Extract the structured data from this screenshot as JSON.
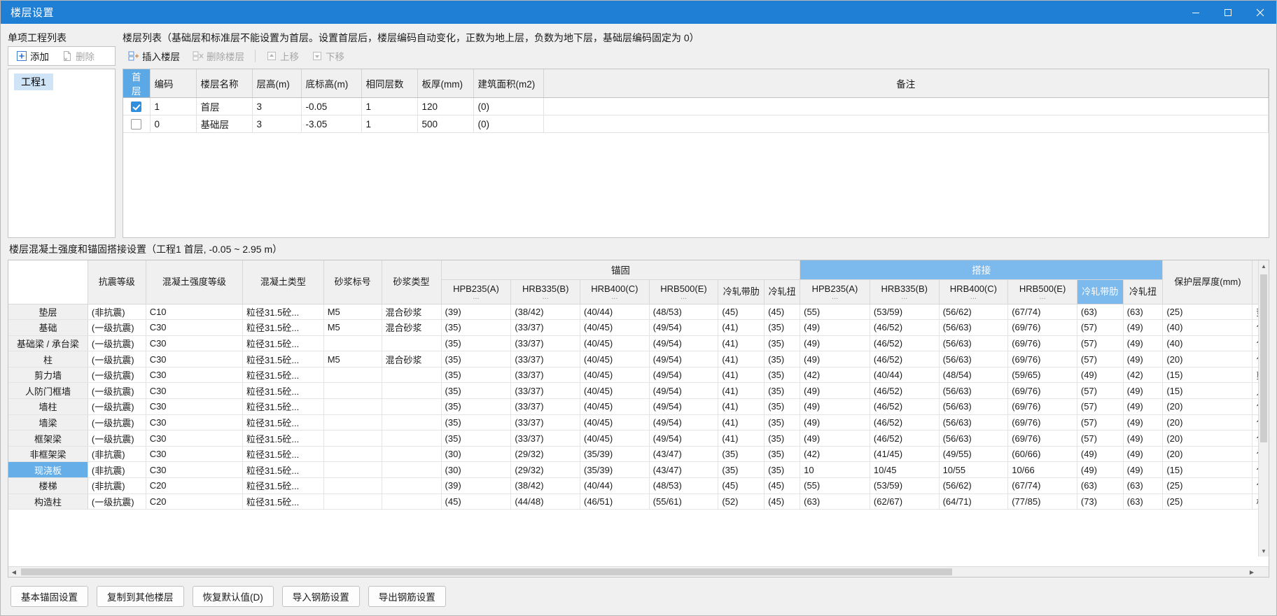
{
  "window": {
    "title": "楼层设置",
    "controls": {
      "minimize": "─",
      "maximize": "☐",
      "close": "✕"
    }
  },
  "left_panel": {
    "label": "单项工程列表",
    "toolbar": [
      {
        "name": "add",
        "label": "添加",
        "icon": "plus-icon",
        "enabled": true
      },
      {
        "name": "delete",
        "label": "删除",
        "icon": "delete-file-icon",
        "enabled": false
      }
    ],
    "projects": [
      {
        "label": "工程1",
        "selected": true
      }
    ]
  },
  "floor_panel": {
    "label": "楼层列表（基础层和标准层不能设置为首层。设置首层后，楼层编码自动变化，正数为地上层，负数为地下层，基础层编码固定为 0）",
    "toolbar": [
      {
        "name": "insert-floor",
        "label": "插入楼层",
        "icon": "insert-row-icon",
        "enabled": true
      },
      {
        "name": "delete-floor",
        "label": "删除楼层",
        "icon": "delete-row-icon",
        "enabled": false
      },
      {
        "name": "move-up",
        "label": "上移",
        "icon": "arrow-up-icon",
        "enabled": false
      },
      {
        "name": "move-down",
        "label": "下移",
        "icon": "arrow-down-icon",
        "enabled": false
      }
    ],
    "columns": [
      "首层",
      "编码",
      "楼层名称",
      "层高(m)",
      "底标高(m)",
      "相同层数",
      "板厚(mm)",
      "建筑面积(m2)",
      "备注"
    ],
    "rows": [
      {
        "first_floor": true,
        "code": "1",
        "name": "首层",
        "height": "3",
        "base_elev": "-0.05",
        "same_count": "1",
        "slab": "120",
        "area": "(0)",
        "note": ""
      },
      {
        "first_floor": false,
        "code": "0",
        "name": "基础层",
        "height": "3",
        "base_elev": "-3.05",
        "same_count": "1",
        "slab": "500",
        "area": "(0)",
        "note": ""
      }
    ]
  },
  "material_section": {
    "title": "楼层混凝土强度和锚固搭接设置（工程1  首层, -0.05 ~ 2.95 m）",
    "group_headers": {
      "anchor": "锚固",
      "lap": "搭接"
    },
    "columns": {
      "rowhead": "",
      "seismic": "抗震等级",
      "concrete_grade": "混凝土强度等级",
      "concrete_type": "混凝土类型",
      "mortar_grade": "砂浆标号",
      "mortar_type": "砂浆类型",
      "rebar": [
        "HPB235(A)",
        "HRB335(B)",
        "HRB400(C)",
        "HRB500(E)",
        "冷轧带肋",
        "冷轧扭"
      ],
      "dots": "...",
      "cover": "保护层厚度(mm)"
    },
    "rows": [
      {
        "name": "垫层",
        "seismic": "(非抗震)",
        "grade": "C10",
        "ctype": "粒径31.5砼...",
        "mgrade": "M5",
        "mtype": "混合砂浆",
        "anchor": [
          "(39)",
          "(38/42)",
          "(40/44)",
          "(48/53)",
          "(45)",
          "(45)"
        ],
        "lap": [
          "(55)",
          "(53/59)",
          "(56/62)",
          "(67/74)",
          "(63)",
          "(63)"
        ],
        "cover": "(25)",
        "note": "垫"
      },
      {
        "name": "基础",
        "seismic": "(一级抗震)",
        "grade": "C30",
        "ctype": "粒径31.5砼...",
        "mgrade": "M5",
        "mtype": "混合砂浆",
        "anchor": [
          "(35)",
          "(33/37)",
          "(40/45)",
          "(49/54)",
          "(41)",
          "(35)"
        ],
        "lap": [
          "(49)",
          "(46/52)",
          "(56/63)",
          "(69/76)",
          "(57)",
          "(49)"
        ],
        "cover": "(40)",
        "note": "包"
      },
      {
        "name": "基础梁 / 承台梁",
        "seismic": "(一级抗震)",
        "grade": "C30",
        "ctype": "粒径31.5砼...",
        "mgrade": "",
        "mtype": "",
        "anchor": [
          "(35)",
          "(33/37)",
          "(40/45)",
          "(49/54)",
          "(41)",
          "(35)"
        ],
        "lap": [
          "(49)",
          "(46/52)",
          "(56/63)",
          "(69/76)",
          "(57)",
          "(49)"
        ],
        "cover": "(40)",
        "note": "包"
      },
      {
        "name": "柱",
        "seismic": "(一级抗震)",
        "grade": "C30",
        "ctype": "粒径31.5砼...",
        "mgrade": "M5",
        "mtype": "混合砂浆",
        "anchor": [
          "(35)",
          "(33/37)",
          "(40/45)",
          "(49/54)",
          "(41)",
          "(35)"
        ],
        "lap": [
          "(49)",
          "(46/52)",
          "(56/63)",
          "(69/76)",
          "(57)",
          "(49)"
        ],
        "cover": "(20)",
        "note": "包"
      },
      {
        "name": "剪力墙",
        "seismic": "(一级抗震)",
        "grade": "C30",
        "ctype": "粒径31.5砼...",
        "mgrade": "",
        "mtype": "",
        "anchor": [
          "(35)",
          "(33/37)",
          "(40/45)",
          "(49/54)",
          "(41)",
          "(35)"
        ],
        "lap": [
          "(42)",
          "(40/44)",
          "(48/54)",
          "(59/65)",
          "(49)",
          "(42)"
        ],
        "cover": "(15)",
        "note": "剪"
      },
      {
        "name": "人防门框墙",
        "seismic": "(一级抗震)",
        "grade": "C30",
        "ctype": "粒径31.5砼...",
        "mgrade": "",
        "mtype": "",
        "anchor": [
          "(35)",
          "(33/37)",
          "(40/45)",
          "(49/54)",
          "(41)",
          "(35)"
        ],
        "lap": [
          "(49)",
          "(46/52)",
          "(56/63)",
          "(69/76)",
          "(57)",
          "(49)"
        ],
        "cover": "(15)",
        "note": "人"
      },
      {
        "name": "墙柱",
        "seismic": "(一级抗震)",
        "grade": "C30",
        "ctype": "粒径31.5砼...",
        "mgrade": "",
        "mtype": "",
        "anchor": [
          "(35)",
          "(33/37)",
          "(40/45)",
          "(49/54)",
          "(41)",
          "(35)"
        ],
        "lap": [
          "(49)",
          "(46/52)",
          "(56/63)",
          "(69/76)",
          "(57)",
          "(49)"
        ],
        "cover": "(20)",
        "note": "包"
      },
      {
        "name": "墙梁",
        "seismic": "(一级抗震)",
        "grade": "C30",
        "ctype": "粒径31.5砼...",
        "mgrade": "",
        "mtype": "",
        "anchor": [
          "(35)",
          "(33/37)",
          "(40/45)",
          "(49/54)",
          "(41)",
          "(35)"
        ],
        "lap": [
          "(49)",
          "(46/52)",
          "(56/63)",
          "(69/76)",
          "(57)",
          "(49)"
        ],
        "cover": "(20)",
        "note": "包"
      },
      {
        "name": "框架梁",
        "seismic": "(一级抗震)",
        "grade": "C30",
        "ctype": "粒径31.5砼...",
        "mgrade": "",
        "mtype": "",
        "anchor": [
          "(35)",
          "(33/37)",
          "(40/45)",
          "(49/54)",
          "(41)",
          "(35)"
        ],
        "lap": [
          "(49)",
          "(46/52)",
          "(56/63)",
          "(69/76)",
          "(57)",
          "(49)"
        ],
        "cover": "(20)",
        "note": "包"
      },
      {
        "name": "非框架梁",
        "seismic": "(非抗震)",
        "grade": "C30",
        "ctype": "粒径31.5砼...",
        "mgrade": "",
        "mtype": "",
        "anchor": [
          "(30)",
          "(29/32)",
          "(35/39)",
          "(43/47)",
          "(35)",
          "(35)"
        ],
        "lap": [
          "(42)",
          "(41/45)",
          "(49/55)",
          "(60/66)",
          "(49)",
          "(49)"
        ],
        "cover": "(20)",
        "note": "包"
      },
      {
        "name": "现浇板",
        "seismic": "(非抗震)",
        "grade": "C30",
        "ctype": "粒径31.5砼...",
        "mgrade": "",
        "mtype": "",
        "anchor": [
          "(30)",
          "(29/32)",
          "(35/39)",
          "(43/47)",
          "(35)",
          "(35)"
        ],
        "lap": [
          "10",
          "10/45",
          "10/55",
          "10/66",
          "(49)",
          "(49)"
        ],
        "cover": "(15)",
        "note": "包",
        "selected_row": true,
        "lap_highlight": [
          true,
          true,
          true,
          true,
          false,
          false
        ],
        "selected_cell_index": 4
      },
      {
        "name": "楼梯",
        "seismic": "(非抗震)",
        "grade": "C20",
        "ctype": "粒径31.5砼...",
        "mgrade": "",
        "mtype": "",
        "anchor": [
          "(39)",
          "(38/42)",
          "(40/44)",
          "(48/53)",
          "(45)",
          "(45)"
        ],
        "lap": [
          "(55)",
          "(53/59)",
          "(56/62)",
          "(67/74)",
          "(63)",
          "(63)"
        ],
        "cover": "(25)",
        "note": "包"
      },
      {
        "name": "构造柱",
        "seismic": "(一级抗震)",
        "grade": "C20",
        "ctype": "粒径31.5砼...",
        "mgrade": "",
        "mtype": "",
        "anchor": [
          "(45)",
          "(44/48)",
          "(46/51)",
          "(55/61)",
          "(52)",
          "(45)"
        ],
        "lap": [
          "(63)",
          "(62/67)",
          "(64/71)",
          "(77/85)",
          "(73)",
          "(63)"
        ],
        "cover": "(25)",
        "note": "构"
      }
    ]
  },
  "footer": {
    "buttons": [
      {
        "name": "basic-anchor-settings",
        "label": "基本锚固设置"
      },
      {
        "name": "copy-to-other-floors",
        "label": "复制到其他楼层"
      },
      {
        "name": "restore-defaults",
        "label": "恢复默认值(D)"
      },
      {
        "name": "import-rebar-settings",
        "label": "导入钢筋设置"
      },
      {
        "name": "export-rebar-settings",
        "label": "导出钢筋设置"
      }
    ]
  },
  "colors": {
    "title_bar": "#1e7fd4",
    "header_highlight": "#7cb9ec",
    "row_selection": "#66aee8",
    "cell_highlight": "#fdf86e",
    "mortar_empty": "#fdfce4"
  }
}
